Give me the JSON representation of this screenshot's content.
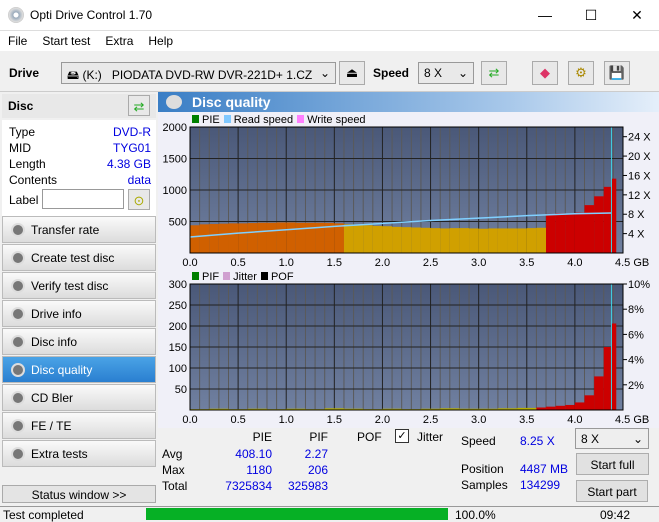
{
  "window": {
    "title": "Opti Drive Control 1.70",
    "minimize": "—",
    "maximize": "☐",
    "close": "✕"
  },
  "menu": [
    "File",
    "Start test",
    "Extra",
    "Help"
  ],
  "toolbar": {
    "drive_label": "Drive",
    "drive_letter": "(K:)",
    "drive_name": "PIODATA DVD-RW DVR-221D+ 1.CZ",
    "speed_label": "Speed",
    "speed_value": "8 X"
  },
  "disc": {
    "header": "Disc",
    "rows": [
      {
        "k": "Type",
        "v": "DVD-R"
      },
      {
        "k": "MID",
        "v": "TYG01"
      },
      {
        "k": "Length",
        "v": "4.38 GB"
      },
      {
        "k": "Contents",
        "v": "data"
      }
    ],
    "label_key": "Label",
    "label_value": ""
  },
  "nav": [
    {
      "label": "Transfer rate"
    },
    {
      "label": "Create test disc"
    },
    {
      "label": "Verify test disc"
    },
    {
      "label": "Drive info"
    },
    {
      "label": "Disc info"
    },
    {
      "label": "Disc quality",
      "active": true
    },
    {
      "label": "CD Bler"
    },
    {
      "label": "FE / TE"
    },
    {
      "label": "Extra tests"
    }
  ],
  "status_window": "Status window >>",
  "panel_title": "Disc quality",
  "legend1": [
    {
      "name": "PIE",
      "color": "#008000"
    },
    {
      "name": "Read speed",
      "color": "#80c8ff"
    },
    {
      "name": "Write speed",
      "color": "#ff80ff"
    }
  ],
  "legend2": [
    {
      "name": "PIF",
      "color": "#008000"
    },
    {
      "name": "Jitter",
      "color": "#d0a0d0"
    },
    {
      "name": "POF",
      "color": "#000000"
    }
  ],
  "chart_data": [
    {
      "type": "bar",
      "x_unit": "GB",
      "xlim": [
        0,
        4.5
      ],
      "xticks": [
        "0.0",
        "0.5",
        "1.0",
        "1.5",
        "2.0",
        "2.5",
        "3.0",
        "3.5",
        "4.0",
        "4.5 GB"
      ],
      "ylim": [
        0,
        2000
      ],
      "yticks": [
        "500",
        "1000",
        "1500",
        "2000"
      ],
      "y2lim": [
        0,
        26
      ],
      "y2ticks": [
        "4 X",
        "8 X",
        "12 X",
        "16 X",
        "20 X",
        "24 X"
      ],
      "series": [
        {
          "name": "PIE",
          "x": [
            0.0,
            0.1,
            0.2,
            0.3,
            0.4,
            0.5,
            0.6,
            0.7,
            0.8,
            0.9,
            1.0,
            1.1,
            1.2,
            1.3,
            1.4,
            1.5,
            1.6,
            1.7,
            1.8,
            1.9,
            2.0,
            2.1,
            2.2,
            2.3,
            2.4,
            2.5,
            2.6,
            2.7,
            2.8,
            2.9,
            3.0,
            3.1,
            3.2,
            3.3,
            3.4,
            3.5,
            3.6,
            3.7,
            3.8,
            3.9,
            4.0,
            4.1,
            4.2,
            4.3,
            4.38
          ],
          "values": [
            440,
            455,
            460,
            465,
            470,
            470,
            475,
            480,
            480,
            485,
            485,
            480,
            480,
            480,
            478,
            470,
            455,
            445,
            440,
            430,
            425,
            415,
            410,
            405,
            400,
            395,
            390,
            395,
            395,
            390,
            385,
            390,
            390,
            390,
            390,
            395,
            400,
            620,
            630,
            620,
            640,
            760,
            900,
            1050,
            1180
          ]
        },
        {
          "name": "Read speed",
          "x": [
            0.0,
            0.5,
            1.0,
            1.5,
            2.0,
            2.5,
            3.0,
            3.5,
            4.0,
            4.38
          ],
          "values": [
            3.3,
            4.1,
            4.8,
            5.5,
            6.1,
            6.7,
            7.2,
            7.7,
            8.1,
            8.25
          ]
        }
      ]
    },
    {
      "type": "bar",
      "x_unit": "GB",
      "xlim": [
        0,
        4.5
      ],
      "xticks": [
        "0.0",
        "0.5",
        "1.0",
        "1.5",
        "2.0",
        "2.5",
        "3.0",
        "3.5",
        "4.0",
        "4.5 GB"
      ],
      "ylim": [
        0,
        300
      ],
      "yticks": [
        "50",
        "100",
        "150",
        "200",
        "250",
        "300"
      ],
      "y2lim": [
        0,
        10
      ],
      "y2ticks": [
        "2%",
        "4%",
        "6%",
        "8%",
        "10%"
      ],
      "series": [
        {
          "name": "PIF",
          "x": [
            0.0,
            0.2,
            0.4,
            0.6,
            0.8,
            1.0,
            1.2,
            1.4,
            1.6,
            1.8,
            2.0,
            2.2,
            2.4,
            2.6,
            2.8,
            3.0,
            3.2,
            3.4,
            3.6,
            3.7,
            3.8,
            3.9,
            4.0,
            4.1,
            4.2,
            4.3,
            4.38
          ],
          "values": [
            2,
            3,
            2,
            3,
            2,
            3,
            2,
            4,
            3,
            2,
            3,
            2,
            3,
            4,
            3,
            3,
            4,
            5,
            6,
            8,
            10,
            12,
            18,
            35,
            80,
            150,
            206
          ]
        }
      ]
    }
  ],
  "stats": {
    "headers": [
      "PIE",
      "PIF",
      "POF"
    ],
    "jitter_label": "Jitter",
    "jitter_checked": true,
    "rows": [
      {
        "k": "Avg",
        "pie": "408.10",
        "pif": "2.27"
      },
      {
        "k": "Max",
        "pie": "1180",
        "pif": "206"
      },
      {
        "k": "Total",
        "pie": "7325834",
        "pif": "325983"
      }
    ],
    "speed_label": "Speed",
    "speed_value": "8.25 X",
    "position_label": "Position",
    "position_value": "4487 MB",
    "samples_label": "Samples",
    "samples_value": "134299",
    "speed_select": "8 X",
    "start_full": "Start full",
    "start_part": "Start part"
  },
  "status": {
    "text": "Test completed",
    "progress": 100,
    "progress_text": "100.0%",
    "time": "09:42",
    "bar_color": "#06b025"
  }
}
